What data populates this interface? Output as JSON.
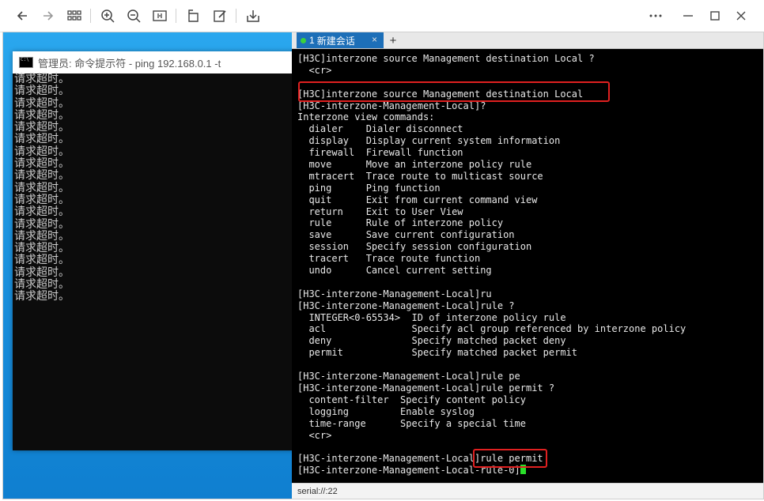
{
  "toolbar": {
    "buttons": [
      "back-icon",
      "forward-icon",
      "grid-icon",
      "zoom-in-icon",
      "zoom-out-icon",
      "fit-icon",
      "rotate-icon",
      "edit-icon",
      "save-icon"
    ],
    "window_controls": [
      "more-icon",
      "minimize-icon",
      "maximize-icon",
      "close-icon"
    ]
  },
  "cmd_window": {
    "title": "管理员: 命令提示符 - ping  192.168.0.1 -t",
    "lines": [
      "请求超时。",
      "请求超时。",
      "请求超时。",
      "请求超时。",
      "请求超时。",
      "请求超时。",
      "请求超时。",
      "请求超时。",
      "请求超时。",
      "请求超时。",
      "请求超时。",
      "请求超时。",
      "请求超时。",
      "请求超时。",
      "请求超时。",
      "请求超时。",
      "请求超时。",
      "请求超时。",
      "请求超时。"
    ]
  },
  "terminal": {
    "tab": {
      "index": "1",
      "label": "新建会话",
      "close": "×"
    },
    "add_tab": "+",
    "lines": [
      "[H3C]interzone source Management destination Local ?",
      "  <cr>",
      "",
      "[H3C]interzone source Management destination Local",
      "[H3C-interzone-Management-Local]?",
      "Interzone view commands:",
      "  dialer    Dialer disconnect",
      "  display   Display current system information",
      "  firewall  Firewall function",
      "  move      Move an interzone policy rule",
      "  mtracert  Trace route to multicast source",
      "  ping      Ping function",
      "  quit      Exit from current command view",
      "  return    Exit to User View",
      "  rule      Rule of interzone policy",
      "  save      Save current configuration",
      "  session   Specify session configuration",
      "  tracert   Trace route function",
      "  undo      Cancel current setting",
      "",
      "[H3C-interzone-Management-Local]ru",
      "[H3C-interzone-Management-Local]rule ?",
      "  INTEGER<0-65534>  ID of interzone policy rule",
      "  acl               Specify acl group referenced by interzone policy",
      "  deny              Specify matched packet deny",
      "  permit            Specify matched packet permit",
      "",
      "[H3C-interzone-Management-Local]rule pe",
      "[H3C-interzone-Management-Local]rule permit ?",
      "  content-filter  Specify content policy",
      "  logging         Enable syslog",
      "  time-range      Specify a special time",
      "  <cr>",
      "",
      "[H3C-interzone-Management-Local]rule permit",
      "[H3C-interzone-Management-Local-rule-0]"
    ],
    "status": "serial://:22"
  },
  "colors": {
    "highlight": "#e02020",
    "cursor": "#2ae02a",
    "tab": "#1d6fb8",
    "desktop": "#1c96e2"
  }
}
